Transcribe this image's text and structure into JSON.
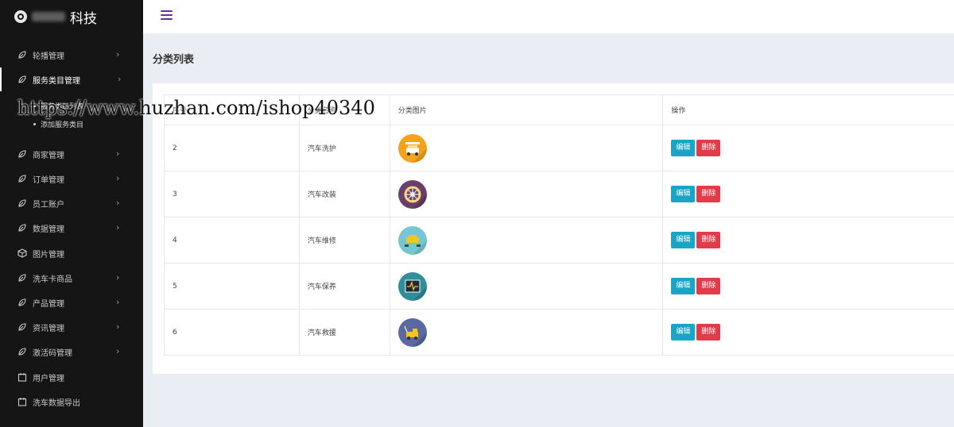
{
  "brand": {
    "text": "科技"
  },
  "sidebar": {
    "items": [
      {
        "label": "轮播管理",
        "icon": "leaf-icon",
        "chevron": "›"
      },
      {
        "label": "服务类目管理",
        "icon": "leaf-icon",
        "chevron": "›",
        "active": true
      },
      {
        "label": "商家管理",
        "icon": "leaf-icon",
        "chevron": "›"
      },
      {
        "label": "订单管理",
        "icon": "leaf-icon",
        "chevron": "›"
      },
      {
        "label": "员工账户",
        "icon": "leaf-icon",
        "chevron": "›"
      },
      {
        "label": "数据管理",
        "icon": "leaf-icon",
        "chevron": "›"
      },
      {
        "label": "图片管理",
        "icon": "box-icon",
        "chevron": ""
      },
      {
        "label": "洗车卡商品",
        "icon": "leaf-icon",
        "chevron": "›"
      },
      {
        "label": "产品管理",
        "icon": "leaf-icon",
        "chevron": "›"
      },
      {
        "label": "资讯管理",
        "icon": "leaf-icon",
        "chevron": "›"
      },
      {
        "label": "激活码管理",
        "icon": "leaf-icon",
        "chevron": "›"
      },
      {
        "label": "用户管理",
        "icon": "calendar-icon",
        "chevron": ""
      },
      {
        "label": "洗车数据导出",
        "icon": "calendar-icon",
        "chevron": ""
      }
    ],
    "submenu": [
      {
        "label": "服务类目列表"
      },
      {
        "label": "添加服务类目"
      }
    ]
  },
  "page": {
    "title": "分类列表"
  },
  "table": {
    "headers": [
      "序号",
      "分类名称",
      "分类图片",
      "操作"
    ],
    "rows": [
      {
        "id": "2",
        "name": "汽车洗护",
        "image_color": "#f2a31b",
        "image_icon": "car-wash-icon"
      },
      {
        "id": "3",
        "name": "汽车改装",
        "image_color": "#6a3f6b",
        "image_icon": "wheel-icon"
      },
      {
        "id": "4",
        "name": "汽车维修",
        "image_color": "#74c6d3",
        "image_icon": "car-repair-icon"
      },
      {
        "id": "5",
        "name": "汽车保养",
        "image_color": "#2e8f9a",
        "image_icon": "monitor-icon"
      },
      {
        "id": "6",
        "name": "汽车救援",
        "image_color": "#5a6aa0",
        "image_icon": "tow-truck-icon"
      }
    ],
    "actions": {
      "edit": "编辑",
      "delete": "删除"
    }
  },
  "watermark": {
    "text": "https://www.huzhan.com/ishop40340"
  }
}
